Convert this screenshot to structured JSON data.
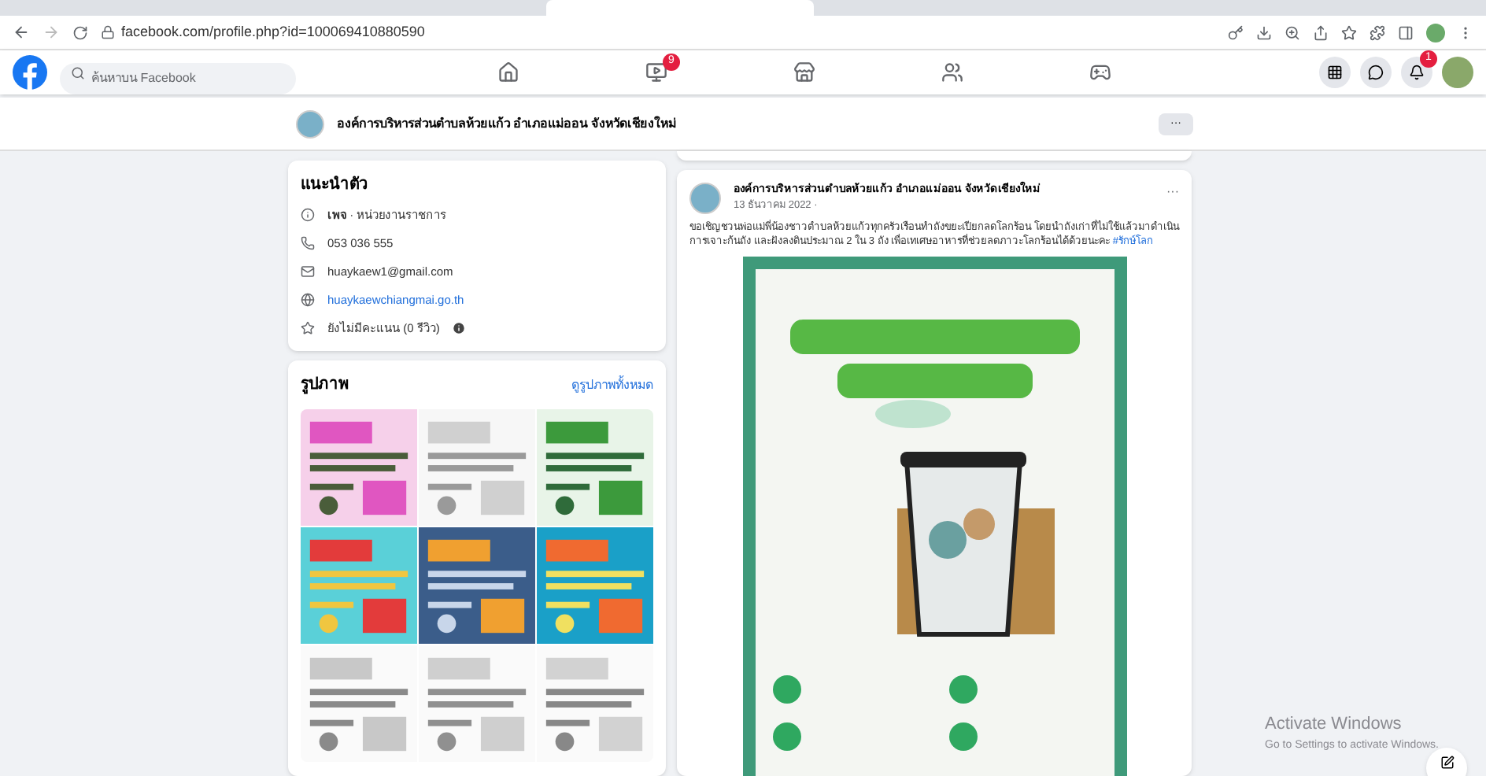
{
  "browser": {
    "url": "facebook.com/profile.php?id=100069410880590"
  },
  "header": {
    "search": {
      "placeholder": "ค้นหาบน Facebook"
    },
    "nav": [
      {
        "kind": "home",
        "selected": false
      },
      {
        "kind": "video",
        "selected": false,
        "badge": "9"
      },
      {
        "kind": "market",
        "selected": false
      },
      {
        "kind": "groups",
        "selected": false
      },
      {
        "kind": "gaming",
        "selected": false
      }
    ],
    "notification_badge": "1"
  },
  "page_bar": {
    "name": "องค์การบริหารส่วนตำบลห้วยแก้ว อำเภอแม่ออน จังหวัดเชียงใหม่",
    "more": "···"
  },
  "intro": {
    "title": "แนะนำตัว",
    "items": [
      {
        "kind": "info",
        "text": "**เพจ** · หน่วยงานราชการ"
      },
      {
        "kind": "phone",
        "text": "053 036 555"
      },
      {
        "kind": "email",
        "text": "huaykaew1@gmail.com"
      },
      {
        "kind": "website",
        "text": "huaykaewchiangmai.go.th"
      },
      {
        "kind": "rating",
        "text": "ยังไม่มีคะแนน (0 รีวิว)"
      }
    ]
  },
  "photos": {
    "title": "รูปภาพ",
    "link": "ดูรูปภาพทั้งหมด"
  },
  "post": {
    "author": "องค์การบริหารส่วนตำบลห้วยแก้ว อำเภอแม่ออน จังหวัดเชียงใหม่",
    "date": "13 ธันวาคม 2022 ·",
    "more": "···",
    "text": "ขอเชิญชวนพ่อแม่พี่น้องชาวตำบลห้วยแก้วทุกครัวเรือนทำถังขยะเปียกลดโลกร้อน โดยนำถังเก่าที่ไม่ใช้แล้วมาดำเนินการเจาะก้นถัง และฝังลงดินประมาณ 2 ใน 3 ถัง เพื่อเทเศษอาหารที่ช่วยลดภาวะโลกร้อนได้ด้วยนะคะ",
    "hashtag": "#รักษ์โลก"
  },
  "os_notice": {
    "title": "Activate Windows",
    "subtitle": "Go to Settings to activate Windows."
  }
}
